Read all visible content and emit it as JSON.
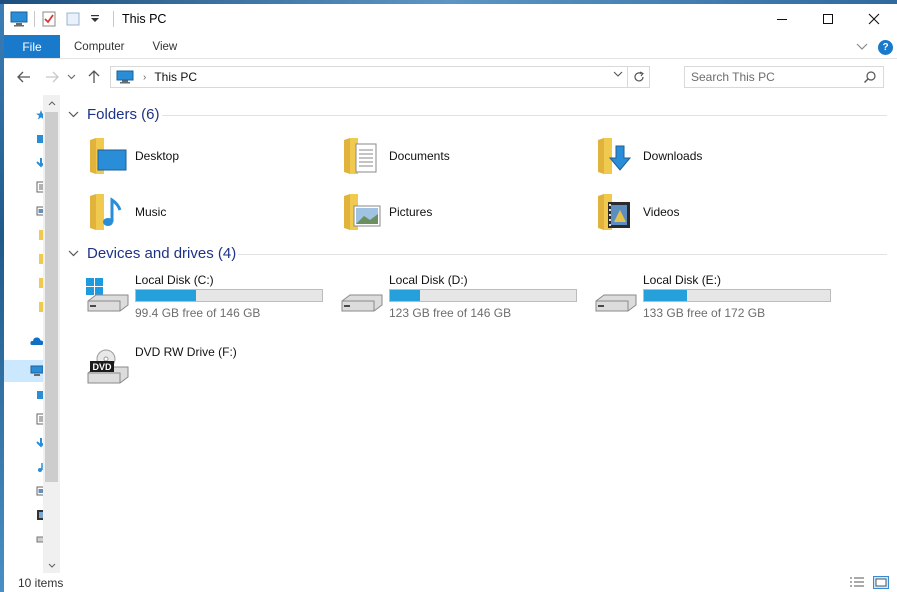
{
  "window": {
    "title": "This PC",
    "controls": {
      "minimize": "—",
      "maximize": "☐",
      "close": "✕"
    }
  },
  "ribbon": {
    "file_tab": "File",
    "tabs": [
      "Computer",
      "View"
    ],
    "expand_glyph": "⌄",
    "help_glyph": "?"
  },
  "nav": {
    "back": "←",
    "forward": "→",
    "recent": "⌄",
    "up": "↑"
  },
  "address": {
    "path": "This PC",
    "chevron": "›",
    "dropdown": "⌄",
    "refresh": "↻"
  },
  "search": {
    "placeholder": "Search This PC"
  },
  "groups": {
    "folders": {
      "header": "Folders (6)",
      "items": [
        {
          "label": "Desktop",
          "icon": "desktop-folder-icon"
        },
        {
          "label": "Documents",
          "icon": "documents-folder-icon"
        },
        {
          "label": "Downloads",
          "icon": "downloads-folder-icon"
        },
        {
          "label": "Music",
          "icon": "music-folder-icon"
        },
        {
          "label": "Pictures",
          "icon": "pictures-folder-icon"
        },
        {
          "label": "Videos",
          "icon": "videos-folder-icon"
        }
      ]
    },
    "drives": {
      "header": "Devices and drives (4)",
      "items": [
        {
          "name": "Local Disk (C:)",
          "free": "99.4 GB free of 146 GB",
          "used_fraction": 0.32,
          "icon": "windows-drive-icon"
        },
        {
          "name": "Local Disk (D:)",
          "free": "123 GB free of 146 GB",
          "used_fraction": 0.16,
          "icon": "hard-drive-icon"
        },
        {
          "name": "Local Disk (E:)",
          "free": "133 GB free of 172 GB",
          "used_fraction": 0.23,
          "icon": "hard-drive-icon"
        },
        {
          "name": "DVD RW Drive (F:)",
          "icon": "dvd-drive-icon",
          "dvd_label": "DVD"
        }
      ]
    }
  },
  "status": {
    "items": "10 items"
  },
  "colors": {
    "accent": "#1979ca",
    "bar_fill": "#26a0da",
    "header_text": "#1e3287",
    "folder_yellow": "#f0c94f"
  }
}
